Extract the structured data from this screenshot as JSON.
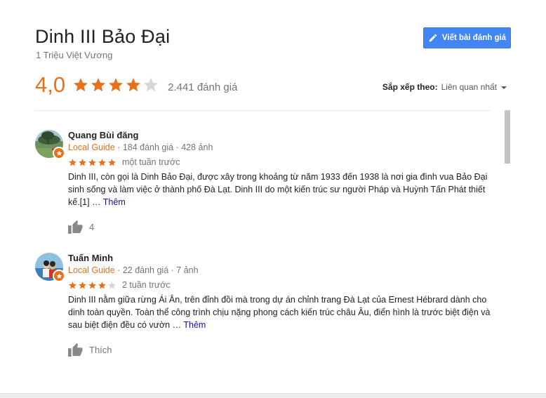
{
  "place": {
    "title": "Dinh III Bảo Đại",
    "address": "1 Triệu Việt Vương"
  },
  "write_review": {
    "label": "Viết bài đánh giá",
    "icon": "pencil-icon"
  },
  "summary": {
    "rating": "4,0",
    "stars": 4,
    "review_count": "2.441 đánh giá"
  },
  "sort": {
    "label": "Sắp xếp theo:",
    "value": "Liên quan nhất"
  },
  "colors": {
    "accent": "#e7711b",
    "button": "#4285f4",
    "link": "#1a0dab",
    "muted": "#70757a"
  },
  "reviews": [
    {
      "name": "Quang Bùi đăng",
      "guide": "Local Guide",
      "stats": " · 184 đánh giá · 428 ảnh",
      "stars": 5,
      "time": "một tuần trước",
      "text": "Dinh III, còn gọi là Dinh Bảo Đại, được xây trong khoảng từ năm 1933 đến 1938 là nơi gia đình vua Bảo Đại sinh sống và làm việc ở thành phố Đà Lạt. Dinh III do một kiến trúc sư người Pháp và Huỳnh Tấn Phát thiết kế.[1] …",
      "more": "Thêm",
      "likes": "4"
    },
    {
      "name": "Tuấn Minh",
      "guide": "Local Guide",
      "stats": " · 22 đánh giá · 7 ảnh",
      "stars": 4,
      "time": "2 tuần trước",
      "text": "Dinh III nằm giữa rừng Ái Ân, trên đỉnh đồi mà trong dự án chỉnh trang Đà Lạt của Ernest Hébrard dành cho dinh toàn quyền. Toàn thể công trình chịu nặng phong cách kiến trúc châu Âu, điển hình là trước biệt điện và sau biệt điện đều có vườn …",
      "more": "Thêm",
      "likes": "Thích"
    }
  ]
}
